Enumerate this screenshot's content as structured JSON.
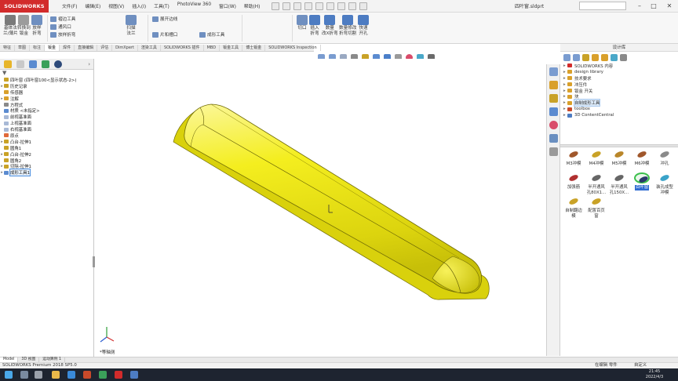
{
  "app": {
    "logo_text": "SOLIDWORKS",
    "menus": [
      "文件(F)",
      "编辑(E)",
      "视图(V)",
      "插入(I)",
      "工具(T)",
      "PhotoView 360",
      "窗口(W)",
      "帮助(H)"
    ],
    "doc_title": "四叶窗.sldprt"
  },
  "ribbon": {
    "buttons": [
      {
        "label": "基体法\n兰/薄片",
        "color": "#7a7a7a"
      },
      {
        "label": "转换到\n钣金",
        "color": "#9c9c9c"
      },
      {
        "label": "放样\n折弯",
        "color": "#6f8fc0"
      },
      {
        "label": "扫描\n法兰",
        "color": "#6f8fc0"
      },
      {
        "label": "切口",
        "color": "#6f8fc0"
      },
      {
        "label": "插入\n折弯",
        "color": "#4d7cc2"
      },
      {
        "label": "焊接的\n边角",
        "color": "#5b8bd0"
      },
      {
        "label": "展开",
        "color": "#4d7cc2"
      },
      {
        "label": "折叠",
        "color": "#4d7cc2"
      },
      {
        "label": "简单直孔",
        "color": "#6f8fc0"
      },
      {
        "label": "通风口",
        "color": "#6f8fc0"
      },
      {
        "label": "边角",
        "color": "#6f8fc0"
      },
      {
        "label": "断裂边角",
        "color": "#6f8fc0"
      },
      {
        "label": "钣金\n角撑板",
        "color": "#6f8fc0"
      },
      {
        "label": "无折弯",
        "color": "#4d7cc2"
      },
      {
        "label": "切口",
        "color": "#6f8fc0"
      },
      {
        "label": "插入\n折弯",
        "color": "#4d7cc2"
      },
      {
        "label": "数量\n改X折弯",
        "color": "#4d7cc2"
      },
      {
        "label": "数量修改\n折弯切割",
        "color": "#4d7cc2"
      },
      {
        "label": "快速\n开孔",
        "color": "#4d7cc2"
      }
    ],
    "small_buttons": [
      "褶边工具",
      "通风口",
      "放样折弯",
      "展开边线",
      "片和槽口",
      "成形工具"
    ],
    "tabs": [
      "特征",
      "草图",
      "标注",
      "钣金",
      "焊件",
      "直接编辑",
      "评估",
      "DimXpert",
      "渲染工具",
      "SOLIDWORKS 插件",
      "MBD",
      "钣金工具",
      "博士钣金",
      "SOLIDWORKS Inspection"
    ],
    "active_tab": "钣金"
  },
  "feature_tree": {
    "root": "四叶窗 (四叶窗100<显示状态-2>)",
    "items": [
      {
        "label": "历史记录",
        "icon": "history-icon",
        "color": "#c9a227",
        "toggle": "▸"
      },
      {
        "label": "传感器",
        "icon": "sensor-icon",
        "color": "#d9a02b",
        "toggle": ""
      },
      {
        "label": "注解",
        "icon": "annotation-icon",
        "color": "#d9a02b",
        "toggle": "▸"
      },
      {
        "label": "方程式",
        "icon": "equation-icon",
        "color": "#8a8a8a",
        "toggle": ""
      },
      {
        "label": "材质 <未指定>",
        "icon": "material-icon",
        "color": "#5b8bd0",
        "toggle": ""
      },
      {
        "label": "前视基准面",
        "icon": "plane-icon",
        "color": "#a8b9d6",
        "toggle": ""
      },
      {
        "label": "上视基准面",
        "icon": "plane-icon",
        "color": "#a8b9d6",
        "toggle": ""
      },
      {
        "label": "右视基准面",
        "icon": "plane-icon",
        "color": "#a8b9d6",
        "toggle": ""
      },
      {
        "label": "原点",
        "icon": "origin-icon",
        "color": "#e06a3b",
        "toggle": ""
      },
      {
        "label": "凸台-拉伸1",
        "icon": "extrude-icon",
        "color": "#c9a227",
        "toggle": "▸"
      },
      {
        "label": "圆角1",
        "icon": "fillet-icon",
        "color": "#c9a227",
        "toggle": ""
      },
      {
        "label": "凸台-拉伸2",
        "icon": "extrude-icon",
        "color": "#c9a227",
        "toggle": "▸"
      },
      {
        "label": "圆角2",
        "icon": "fillet-icon",
        "color": "#c9a227",
        "toggle": ""
      },
      {
        "label": "切除-拉伸1",
        "icon": "cut-icon",
        "color": "#c9a227",
        "toggle": "▸"
      },
      {
        "label": "成形工具1",
        "icon": "forming-tool-icon",
        "color": "#5b8bd0",
        "toggle": "▸"
      }
    ],
    "selected_index": 14
  },
  "viewport": {
    "triad_label": "*等轴测",
    "part_color": "#f2ec1e"
  },
  "design_library": {
    "title": "设计库",
    "tree": [
      {
        "label": "SOLIDWORKS 内容",
        "color": "#d22b2b"
      },
      {
        "label": "design library",
        "color": "#d9a02b"
      },
      {
        "label": "技术要求",
        "color": "#d9a02b"
      },
      {
        "label": "冲压件",
        "color": "#d9a02b"
      },
      {
        "label": "钣金 开关",
        "color": "#d9a02b"
      },
      {
        "label": "块",
        "color": "#d9a02b"
      },
      {
        "label": "自制成形工具",
        "color": "#d9a02b"
      },
      {
        "label": "toolbox",
        "color": "#c94a2a"
      },
      {
        "label": "3D ContentCentral",
        "color": "#4d7cc2"
      }
    ],
    "selected_index": 6,
    "items": [
      {
        "label": "M3冲模",
        "color": "#a0572b"
      },
      {
        "label": "M4冲模",
        "color": "#c9a227"
      },
      {
        "label": "M5冲模",
        "color": "#b9862a"
      },
      {
        "label": "M6冲模",
        "color": "#a0572b"
      },
      {
        "label": "冲孔",
        "color": "#8a8a8a"
      },
      {
        "label": "加强筋",
        "color": "#b03030"
      },
      {
        "label": "半开通风\n孔80X1...",
        "color": "#666666"
      },
      {
        "label": "半开通风\n孔150X...",
        "color": "#666666"
      },
      {
        "label": "百叶窗",
        "color": "#2a3a6a"
      },
      {
        "label": "装孔成型\n冲模",
        "color": "#3aa3c9"
      },
      {
        "label": "自制翻边\n模",
        "color": "#c9a227"
      },
      {
        "label": "配置百页\n窗",
        "color": "#c9a227"
      }
    ],
    "highlighted_index": 8
  },
  "bottom_tabs": [
    "Model",
    "3D 视图",
    "运动算例 1"
  ],
  "active_bottom_tab": "Model",
  "status": {
    "left": "SOLIDWORKS Premium 2018 SP5.0",
    "editing": "在编辑 零件",
    "units": "自定义"
  },
  "taskbar": {
    "time": "21:45",
    "date": "2022/4/3"
  }
}
